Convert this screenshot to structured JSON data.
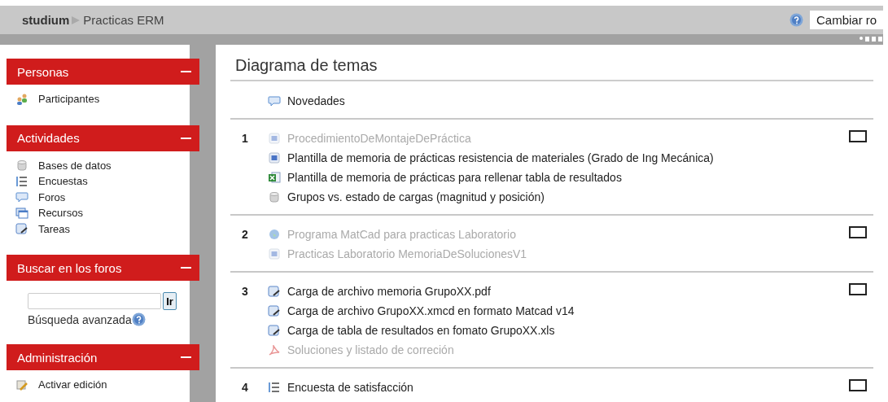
{
  "breadcrumb": {
    "site": "studium",
    "course": "Practicas ERM"
  },
  "role_select": {
    "value": "Cambiar ro"
  },
  "sidebar": [
    {
      "kind": "list",
      "title": "Personas",
      "items": [
        {
          "kind": "participants",
          "label": "Participantes"
        }
      ]
    },
    {
      "kind": "list",
      "title": "Actividades",
      "items": [
        {
          "kind": "database",
          "label": "Bases de datos"
        },
        {
          "kind": "survey",
          "label": "Encuestas"
        },
        {
          "kind": "forum",
          "label": "Foros"
        },
        {
          "kind": "resource",
          "label": "Recursos"
        },
        {
          "kind": "assignment",
          "label": "Tareas"
        }
      ]
    },
    {
      "kind": "search",
      "title": "Buscar en los foros",
      "button": "Ir",
      "link": "Búsqueda avanzada"
    },
    {
      "kind": "list",
      "title": "Administración",
      "items": [
        {
          "kind": "edit",
          "label": "Activar edición"
        }
      ]
    }
  ],
  "main": {
    "title": "Diagrama de temas",
    "news": {
      "kind": "forum",
      "label": "Novedades",
      "dimmed": false
    },
    "sections": [
      {
        "number": "1",
        "highlighted": false,
        "items": [
          {
            "kind": "page",
            "label": "ProcedimientoDeMontajeDePráctica",
            "dimmed": true
          },
          {
            "kind": "page",
            "label": "Plantilla de memoria de prácticas resistencia de materiales (Grado de Ing Mecánica)",
            "dimmed": false
          },
          {
            "kind": "excel",
            "label": "Plantilla de memoria de prácticas para rellenar tabla de resultados",
            "dimmed": false
          },
          {
            "kind": "database",
            "label": "Grupos vs. estado de cargas (magnitud y posición)",
            "dimmed": false
          }
        ]
      },
      {
        "number": "2",
        "highlighted": false,
        "items": [
          {
            "kind": "url",
            "label": "Programa MatCad para practicas Laboratorio",
            "dimmed": true
          },
          {
            "kind": "page",
            "label": "Practicas Laboratorio MemoriaDeSolucionesV1",
            "dimmed": true
          }
        ]
      },
      {
        "number": "3",
        "highlighted": false,
        "items": [
          {
            "kind": "assignment",
            "label": "Carga de archivo memoria GrupoXX.pdf",
            "dimmed": false
          },
          {
            "kind": "assignment",
            "label": "Carga de archivo GrupoXX.xmcd en formato Matcad v14",
            "dimmed": false
          },
          {
            "kind": "assignment",
            "label": "Carga de tabla de resultados en fomato GrupoXX.xls",
            "dimmed": false
          },
          {
            "kind": "pdf",
            "label": "Soluciones y listado de correción",
            "dimmed": true
          }
        ]
      },
      {
        "number": "4",
        "highlighted": false,
        "items": [
          {
            "kind": "survey",
            "label": "Encuesta de satisfacción",
            "dimmed": false
          }
        ]
      }
    ]
  }
}
